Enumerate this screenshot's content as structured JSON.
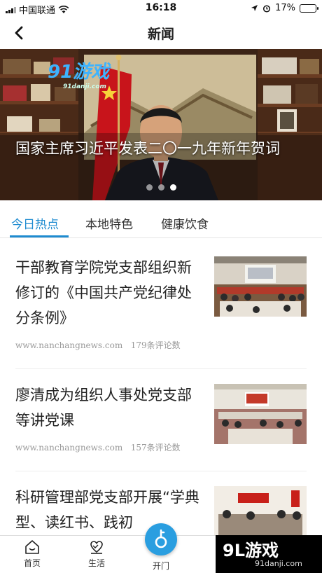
{
  "status_bar": {
    "carrier": "中国联通",
    "time": "16:18",
    "battery": "17%",
    "battery_level": 0.17
  },
  "nav": {
    "title": "新闻",
    "back_icon": "chevron-left-icon"
  },
  "banner": {
    "caption": "国家主席习近平发表二〇一九年新年贺词",
    "watermark": "91游戏",
    "watermark_url": "91danji.com",
    "page_count": 3,
    "active_page": 3
  },
  "tabs": [
    {
      "label": "今日热点",
      "active": true
    },
    {
      "label": "本地特色",
      "active": false
    },
    {
      "label": "健康饮食",
      "active": false
    }
  ],
  "news": [
    {
      "headline": "干部教育学院党支部组织新修订的《中国共产党纪律处分条例》",
      "source": "www.nanchangnews.com",
      "comments": "179条评论数"
    },
    {
      "headline": "廖清成为组织人事处党支部等讲党课",
      "source": "www.nanchangnews.com",
      "comments": "157条评论数"
    },
    {
      "headline": "科研管理部党支部开展“学典型、读红书、践初",
      "source": "",
      "comments": ""
    }
  ],
  "tabbar": {
    "home": "首页",
    "life": "生活",
    "open": "开门"
  },
  "corner_watermark": {
    "text": "9L游戏",
    "url": "91danji.com"
  },
  "colors": {
    "accent": "#1e8bd0",
    "open_button": "#2a9ee0"
  }
}
